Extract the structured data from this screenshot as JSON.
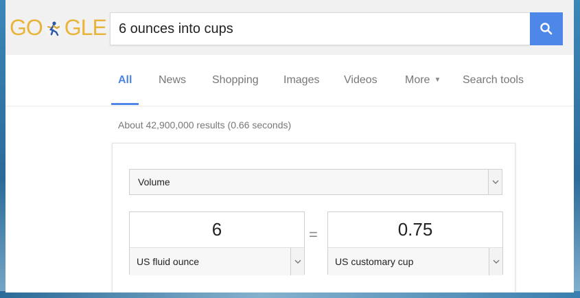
{
  "logo": {
    "left_text": "GO",
    "right_text": "GLE"
  },
  "search": {
    "query": "6 ounces into cups"
  },
  "tabs": [
    {
      "label": "All",
      "active": true
    },
    {
      "label": "News"
    },
    {
      "label": "Shopping"
    },
    {
      "label": "Images"
    },
    {
      "label": "Videos"
    },
    {
      "label": "More",
      "caret": "▼"
    },
    {
      "label": "Search tools"
    }
  ],
  "result_stats": "About 42,900,000 results (0.66 seconds)",
  "converter": {
    "unit_type": "Volume",
    "equals_sign": "=",
    "from": {
      "value": "6",
      "unit": "US fluid ounce"
    },
    "to": {
      "value": "0.75",
      "unit": "US customary cup"
    }
  },
  "colors": {
    "accent": "#4d88e8",
    "logo": "#e9b43a",
    "frame": "#2f6f9e"
  }
}
